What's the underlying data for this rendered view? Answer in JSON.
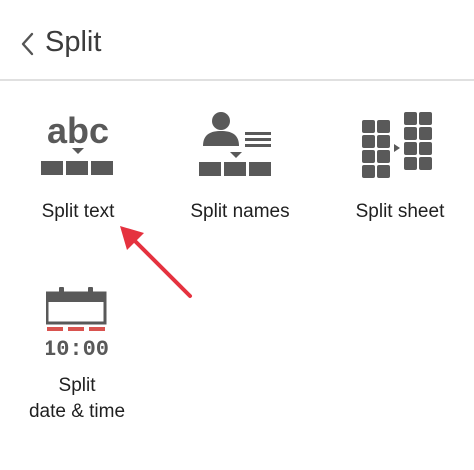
{
  "header": {
    "title": "Split",
    "back_icon": "chevron-left-icon"
  },
  "tiles": [
    {
      "id": "split-text",
      "label": "Split text",
      "icon_text": "abc",
      "icon": "split-text-icon"
    },
    {
      "id": "split-names",
      "label": "Split names",
      "icon": "split-names-icon"
    },
    {
      "id": "split-sheet",
      "label": "Split sheet",
      "icon": "split-sheet-icon"
    },
    {
      "id": "split-date-time",
      "label": "Split\ndate & time",
      "icon_text": "10:00",
      "icon": "split-date-time-icon"
    }
  ],
  "annotation": {
    "icon": "red-arrow-annotation",
    "color": "#e5323f"
  },
  "colors": {
    "icon_gray": "#595959",
    "accent_red": "#d9534f"
  }
}
